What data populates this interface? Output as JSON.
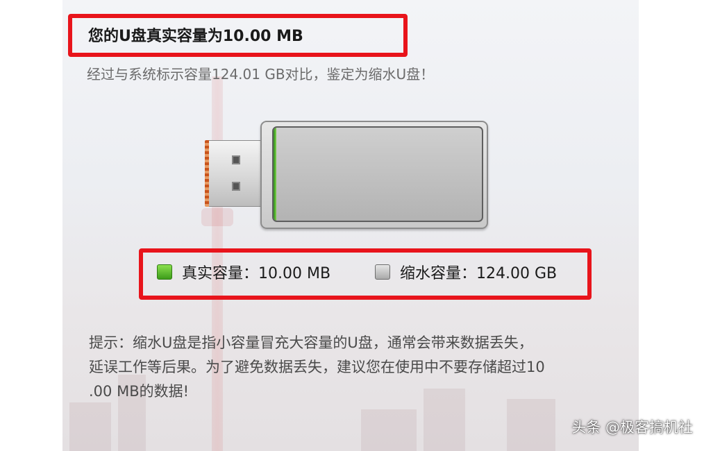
{
  "header": {
    "title": "您的U盘真实容量为10.00 MB",
    "subtitle": "经过与系统标示容量124.01 GB对比，鉴定为缩水U盘！"
  },
  "drive": {
    "real_fraction": 0.0,
    "colors": {
      "real": "#5fbf2e",
      "shrink": "#c8c8c8",
      "highlight": "#e8141b"
    }
  },
  "legend": {
    "real_label": "真实容量：10.00 MB",
    "shrink_label": "缩水容量：124.00 GB"
  },
  "tip": {
    "lines": [
      "提示：缩水U盘是指小容量冒充大容量的U盘，通常会带来数据丢失，",
      "延误工作等后果。为了避免数据丢失，建议您在使用中不要存储超过10",
      ".00 MB的数据!"
    ]
  },
  "watermark": "头条 @极客搞机社"
}
